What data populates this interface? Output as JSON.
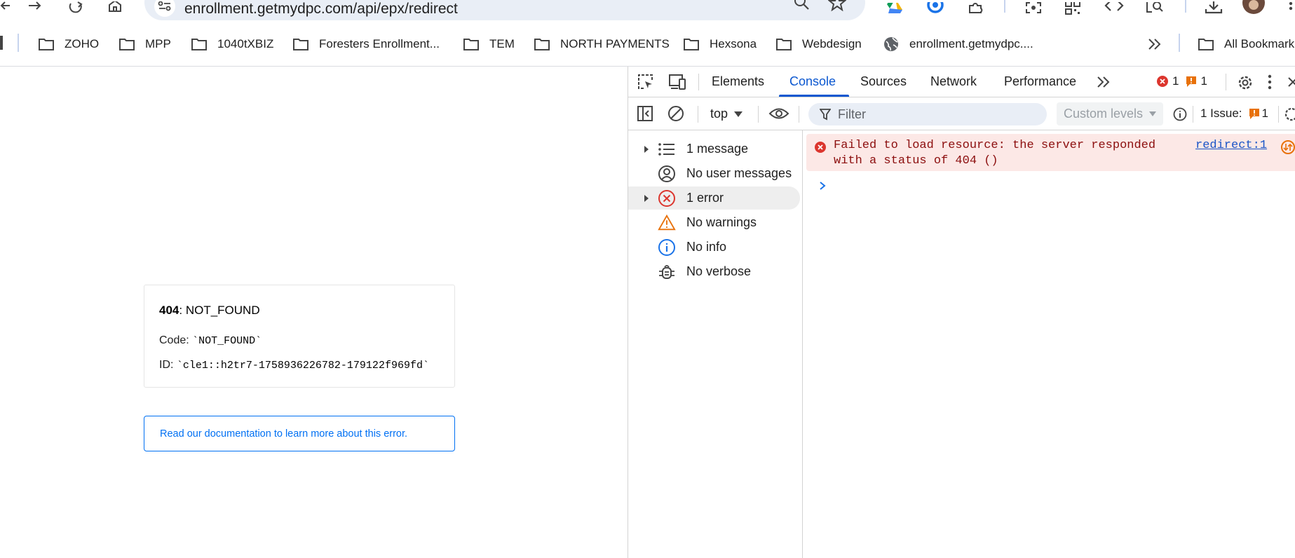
{
  "browser": {
    "url": "enrollment.getmydpc.com/api/epx/redirect",
    "icons": [
      "back-arrow-icon",
      "forward-arrow-icon",
      "reload-icon",
      "home-icon",
      "site-info-icon",
      "zoom-icon",
      "bookmark-star-icon",
      "google-drive-icon",
      "extension-icon",
      "puzzle-icon",
      "screenshot-icon",
      "qr-code-icon",
      "code-icon",
      "lens-search-icon",
      "download-icon",
      "profile-avatar",
      "menu-icon"
    ]
  },
  "bookmarks": {
    "items": [
      {
        "label": "ZOHO"
      },
      {
        "label": "MPP"
      },
      {
        "label": "1040tXBIZ"
      },
      {
        "label": "Foresters Enrollment..."
      },
      {
        "label": "TEM"
      },
      {
        "label": "NORTH PAYMENTS"
      },
      {
        "label": "Hexsona"
      },
      {
        "label": "Webdesign"
      },
      {
        "label": "enrollment.getmydpc...."
      }
    ],
    "all_bookmarks": "All Bookmark"
  },
  "page": {
    "error_code": "404",
    "error_name": ": NOT_FOUND",
    "code_label": "Code: ",
    "code_value": "`NOT_FOUND`",
    "id_label": "ID: ",
    "id_value": "`cle1::h2tr7-1758936226782-179122f969fd`",
    "doc_link": "Read our documentation to learn more about this error."
  },
  "devtools": {
    "tabs": [
      "Elements",
      "Console",
      "Sources",
      "Network",
      "Performance"
    ],
    "active_tab": "Console",
    "error_count": "1",
    "warning_count": "1",
    "toolbar": {
      "context": "top",
      "filter_placeholder": "Filter",
      "levels": "Custom levels",
      "issues_label": "1 Issue:",
      "issues_count": "1"
    },
    "sidebar": [
      {
        "label": "1 message",
        "icon": "list-icon",
        "expandable": true
      },
      {
        "label": "No user messages",
        "icon": "user-icon",
        "expandable": false
      },
      {
        "label": "1 error",
        "icon": "error-icon",
        "expandable": true,
        "selected": true
      },
      {
        "label": "No warnings",
        "icon": "warning-icon",
        "expandable": false
      },
      {
        "label": "No info",
        "icon": "info-icon",
        "expandable": false
      },
      {
        "label": "No verbose",
        "icon": "bug-icon",
        "expandable": false
      }
    ],
    "console": {
      "error_message": "Failed to load resource: the server responded\nwith a status of 404 ()",
      "error_source": "redirect:1"
    }
  },
  "colors": {
    "accent_blue": "#0b57d0",
    "error_red": "#dc362e",
    "warning_orange": "#e8710a",
    "link_blue": "#0070f3",
    "error_bg": "#fce8e6"
  }
}
